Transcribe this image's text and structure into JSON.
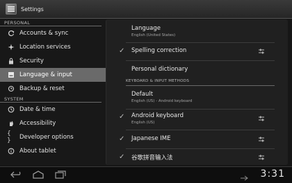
{
  "actionbar": {
    "title": "Settings",
    "icon": "settings-app-icon"
  },
  "left": {
    "sections": [
      {
        "header": "PERSONAL",
        "items": [
          {
            "label": "Accounts & sync",
            "icon": "sync-icon",
            "selected": false
          },
          {
            "label": "Location services",
            "icon": "location-icon",
            "selected": false
          },
          {
            "label": "Security",
            "icon": "lock-icon",
            "selected": false
          },
          {
            "label": "Language & input",
            "icon": "keyboard-icon",
            "selected": true
          },
          {
            "label": "Backup & reset",
            "icon": "backup-icon",
            "selected": false
          }
        ]
      },
      {
        "header": "SYSTEM",
        "items": [
          {
            "label": "Date & time",
            "icon": "clock-icon",
            "selected": false
          },
          {
            "label": "Accessibility",
            "icon": "hand-icon",
            "selected": false
          },
          {
            "label": "Developer options",
            "icon": "braces-icon",
            "selected": false
          },
          {
            "label": "About tablet",
            "icon": "info-icon",
            "selected": false
          }
        ]
      }
    ]
  },
  "right": {
    "language": {
      "title": "Language",
      "subtitle": "English (United States)"
    },
    "spelling": {
      "title": "Spelling correction",
      "checked": true
    },
    "dictionary": {
      "title": "Personal dictionary"
    },
    "keyboard_header": "KEYBOARD & INPUT METHODS",
    "default": {
      "title": "Default",
      "subtitle": "English (US) - Android keyboard"
    },
    "android_kb": {
      "title": "Android keyboard",
      "subtitle": "English (US)"
    },
    "japanese": {
      "title": "Japanese IME"
    },
    "pinyin": {
      "title": "谷歌拼音输入法"
    }
  },
  "navbar": {
    "time": "3:31"
  },
  "colors": {
    "selected_bg": "#6a6a6a",
    "panel_bg": "#202020",
    "bar_bg": "#2e2e2e"
  }
}
